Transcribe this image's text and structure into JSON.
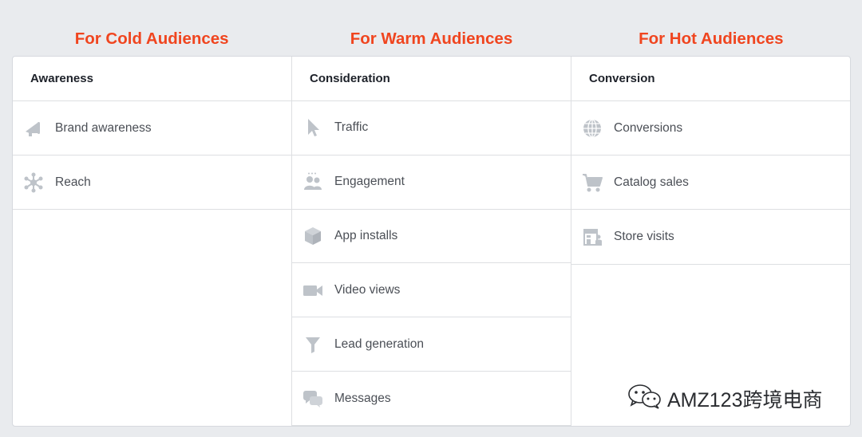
{
  "headers": [
    "For Cold Audiences",
    "For Warm Audiences",
    "For Hot Audiences"
  ],
  "columns": [
    {
      "title": "Awareness",
      "items": [
        {
          "label": "Brand awareness",
          "icon": "megaphone-icon"
        },
        {
          "label": "Reach",
          "icon": "reach-icon"
        }
      ]
    },
    {
      "title": "Consideration",
      "items": [
        {
          "label": "Traffic",
          "icon": "cursor-icon"
        },
        {
          "label": "Engagement",
          "icon": "people-icon"
        },
        {
          "label": "App installs",
          "icon": "box-icon"
        },
        {
          "label": "Video views",
          "icon": "video-camera-icon"
        },
        {
          "label": "Lead generation",
          "icon": "funnel-icon"
        },
        {
          "label": "Messages",
          "icon": "chat-bubbles-icon"
        }
      ]
    },
    {
      "title": "Conversion",
      "items": [
        {
          "label": "Conversions",
          "icon": "globe-icon"
        },
        {
          "label": "Catalog sales",
          "icon": "cart-icon"
        },
        {
          "label": "Store visits",
          "icon": "store-icon"
        }
      ]
    }
  ],
  "watermark": {
    "text": "AMZ123跨境电商",
    "icon": "wechat-icon"
  },
  "colors": {
    "header": "#f0451f",
    "icon": "#bec3c9",
    "background": "#e9ebee"
  }
}
